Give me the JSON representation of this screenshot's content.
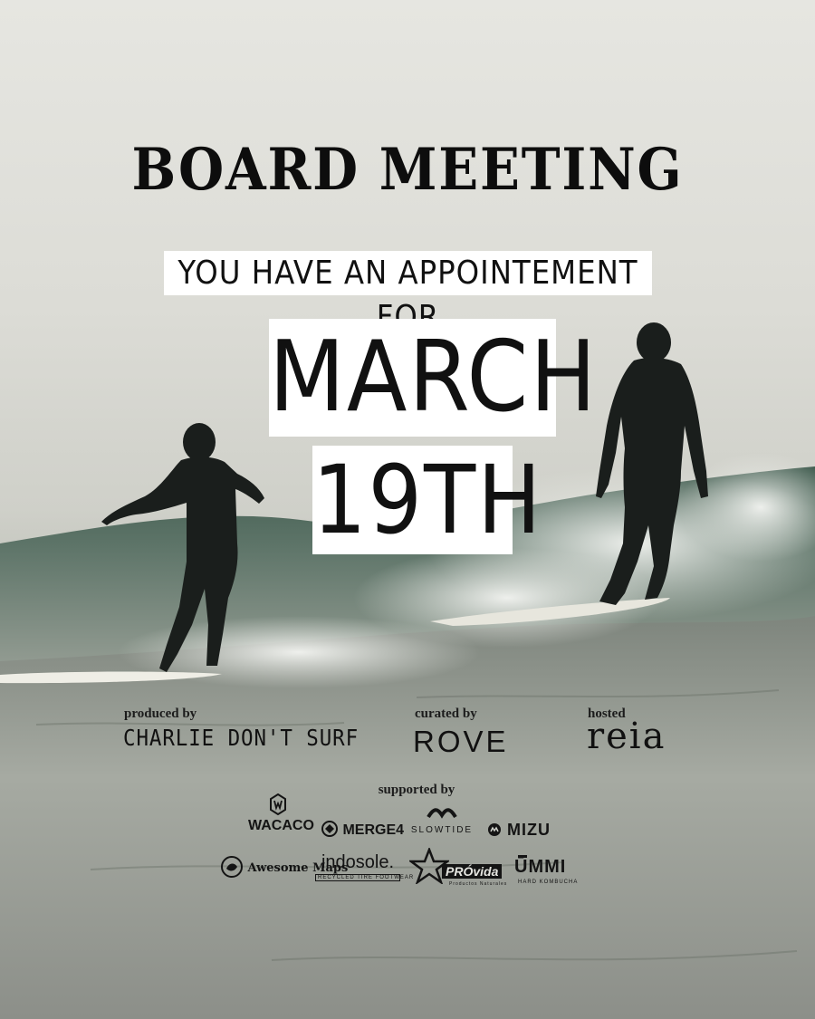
{
  "poster": {
    "title": "BOARD MEETING",
    "subtitle": "YOU HAVE AN APPOINTEMENT FOR",
    "month": "MARCH",
    "day": "19TH"
  },
  "credits": [
    {
      "label": "produced by",
      "name": "CHARLIE DON'T SURF"
    },
    {
      "label": "curated by",
      "name": "ROVE"
    },
    {
      "label": "hosted",
      "name": "reia"
    }
  ],
  "sponsors": {
    "label": "supported by",
    "row1": [
      {
        "name": "WACACO",
        "icon": "wacaco-logo-icon"
      },
      {
        "name": "MERGE4",
        "icon": "merge4-logo-icon"
      },
      {
        "name": "SLOWTIDE",
        "icon": "wave-logo-icon"
      },
      {
        "name": "MIZU",
        "icon": "mizu-logo-icon"
      }
    ],
    "row2": [
      {
        "name": "Awesome Maps",
        "icon": "awesome-maps-logo-icon"
      },
      {
        "name": "indosole.",
        "tagline": "RECYCLED TIRE FOOTWEAR",
        "icon": "indosole-logo-icon"
      },
      {
        "name": "PRÓvida",
        "tagline": "Productos Naturales",
        "icon": "star-logo-icon"
      },
      {
        "name": "ŪMMI",
        "tagline": "HARD KOMBUCHA",
        "icon": "ummi-logo-icon"
      }
    ]
  }
}
